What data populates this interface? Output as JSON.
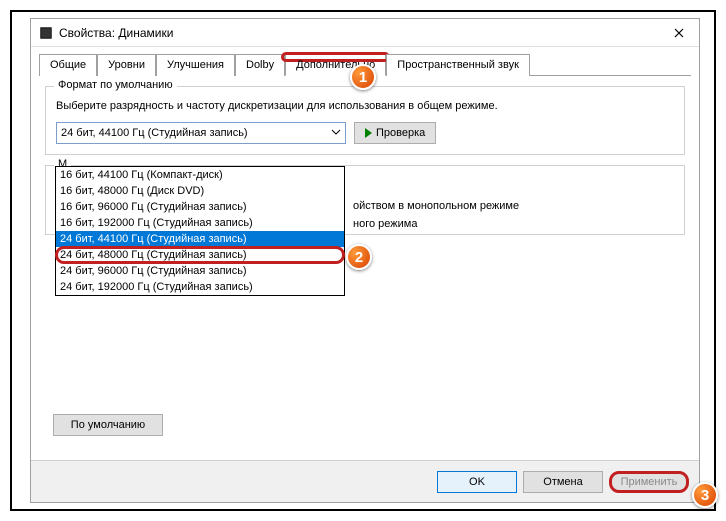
{
  "window": {
    "title": "Свойства: Динамики"
  },
  "tabs": {
    "items": [
      "Общие",
      "Уровни",
      "Улучшения",
      "Dolby",
      "Дополнительно",
      "Пространственный звук"
    ],
    "active_index": 4
  },
  "format_group": {
    "title": "Формат по умолчанию",
    "description": "Выберите разрядность и частоту дискретизации для использования в общем режиме.",
    "selected": "24 бит, 44100 Гц (Студийная запись)",
    "test_button": "Проверка"
  },
  "dropdown": {
    "items": [
      "16 бит, 44100 Гц (Компакт-диск)",
      "16 бит, 48000 Гц (Диск DVD)",
      "16 бит, 96000 Гц (Студийная запись)",
      "16 бит, 192000 Гц (Студийная запись)",
      "24 бит, 44100 Гц (Студийная запись)",
      "24 бит, 48000 Гц (Студийная запись)",
      "24 бит, 96000 Гц (Студийная запись)",
      "24 бит, 192000 Гц (Студийная запись)"
    ],
    "selected_index": 4,
    "highlight_index": 5
  },
  "mono_group": {
    "title_partial": "М",
    "line1_partial": "ойством в монопольном режиме",
    "line2_partial": "ного режима"
  },
  "buttons": {
    "defaults": "По умолчанию",
    "ok": "OK",
    "cancel": "Отмена",
    "apply": "Применить"
  },
  "badges": [
    "1",
    "2",
    "3"
  ]
}
